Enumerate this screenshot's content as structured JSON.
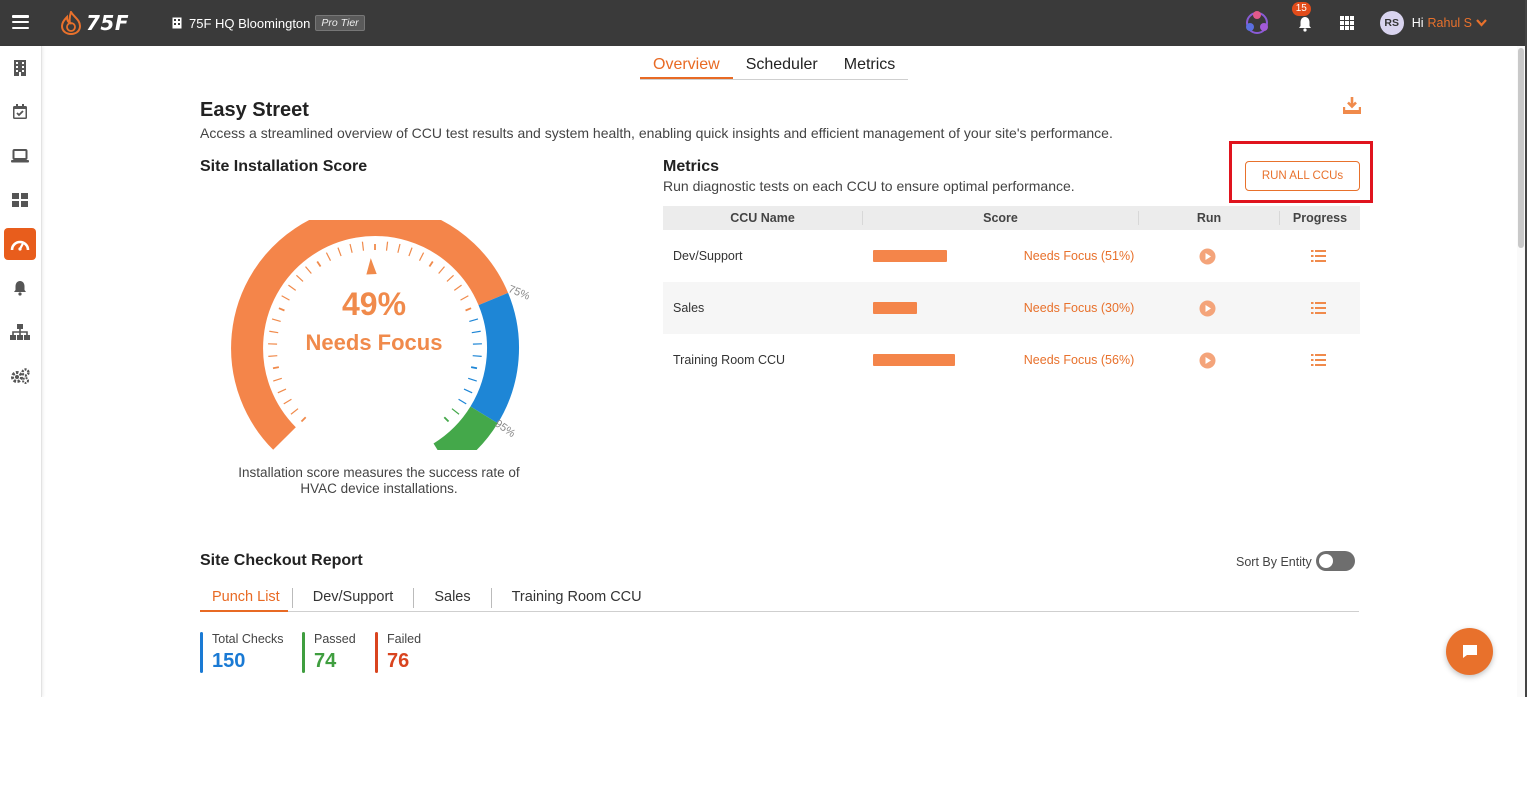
{
  "topbar": {
    "logo_text": "75F",
    "site_name": "75F HQ Bloomington",
    "tier": "Pro Tier",
    "notification_count": "15",
    "avatar_initials": "RS",
    "greeting": "Hi",
    "user_name": "Rahul S",
    "brand_color": "#e8712c"
  },
  "sidebar": {
    "items": [
      {
        "icon": "building-icon"
      },
      {
        "icon": "calendar-check-icon"
      },
      {
        "icon": "laptop-icon"
      },
      {
        "icon": "dashboard-grid-icon"
      },
      {
        "icon": "speedometer-icon",
        "active": true
      },
      {
        "icon": "bell-icon"
      },
      {
        "icon": "sitemap-icon"
      },
      {
        "icon": "gears-icon"
      }
    ]
  },
  "tabs": [
    "Overview",
    "Scheduler",
    "Metrics"
  ],
  "active_tab": "Overview",
  "page": {
    "title": "Easy Street",
    "subtitle": "Access a streamlined overview of CCU test results and system health, enabling quick insights and efficient management of your site's performance."
  },
  "installation": {
    "heading": "Site Installation Score",
    "score_percent": 49,
    "score_label": "49%",
    "status": "Needs Focus",
    "marker_75": "75%",
    "marker_95": "95%",
    "note": "Installation score measures the success rate of HVAC device installations."
  },
  "metrics": {
    "heading": "Metrics",
    "subtitle": "Run diagnostic tests on each CCU to ensure optimal performance.",
    "run_all_label": "RUN ALL CCUs",
    "columns": [
      "CCU Name",
      "Score",
      "Run",
      "Progress"
    ],
    "rows": [
      {
        "name": "Dev/Support",
        "score": 51,
        "score_text": "Needs Focus (51%)"
      },
      {
        "name": "Sales",
        "score": 30,
        "score_text": "Needs Focus (30%)"
      },
      {
        "name": "Training Room CCU",
        "score": 56,
        "score_text": "Needs Focus (56%)"
      }
    ]
  },
  "checkout": {
    "heading": "Site Checkout Report",
    "sort_label": "Sort By Entity",
    "sort_on": false,
    "tabs": [
      "Punch List",
      "Dev/Support",
      "Sales",
      "Training Room CCU"
    ],
    "active_tab": "Punch List",
    "stats": [
      {
        "label": "Total Checks",
        "value": "150",
        "color": "#1a7ad4"
      },
      {
        "label": "Passed",
        "value": "74",
        "color": "#3f9e3f"
      },
      {
        "label": "Failed",
        "value": "76",
        "color": "#d9441f"
      }
    ]
  }
}
